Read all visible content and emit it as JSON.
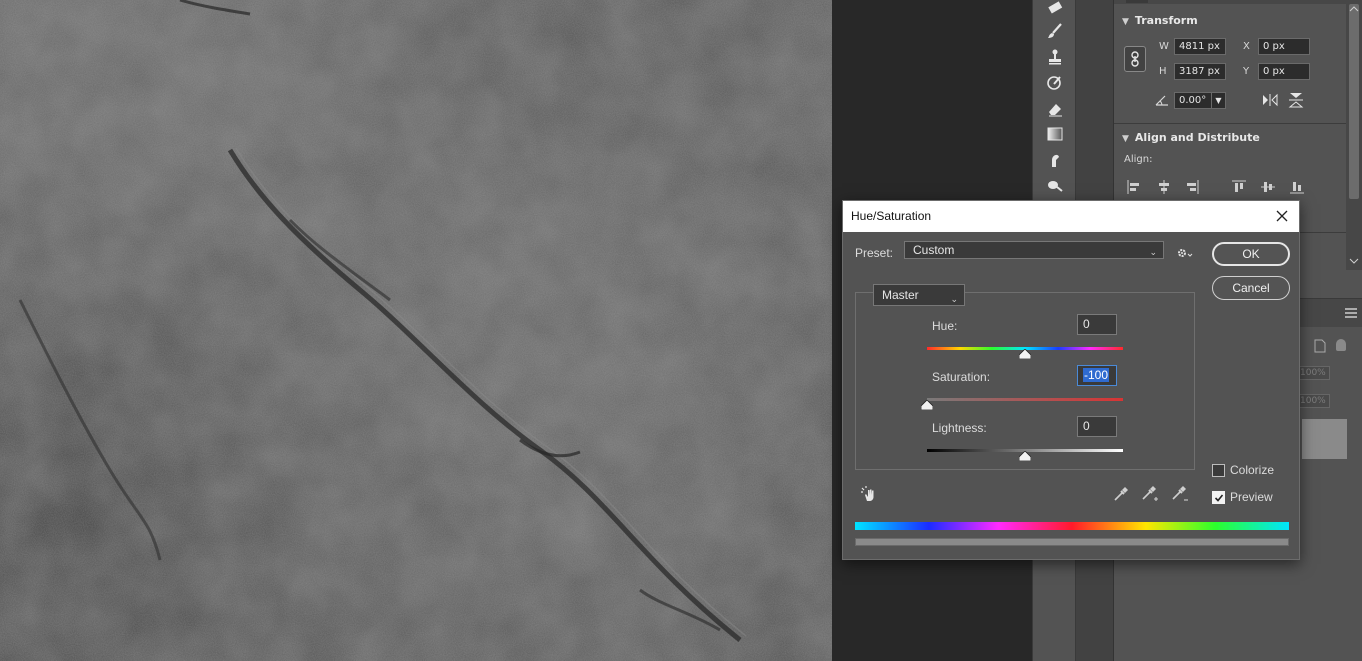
{
  "properties": {
    "transform_title": "Transform",
    "w_label": "W",
    "w_value": "4811 px",
    "h_label": "H",
    "h_value": "3187 px",
    "x_label": "X",
    "x_value": "0 px",
    "y_label": "Y",
    "y_value": "0 px",
    "angle_value": "0.00°",
    "align_title": "Align and Distribute",
    "align_label": "Align:"
  },
  "layers": {
    "opacity_1": "100%",
    "opacity_2": "100%"
  },
  "dialog": {
    "title": "Hue/Saturation",
    "preset_label": "Preset:",
    "preset_value": "Custom",
    "ok_label": "OK",
    "cancel_label": "Cancel",
    "channel_value": "Master",
    "hue_label": "Hue:",
    "hue_value": "0",
    "saturation_label": "Saturation:",
    "saturation_value": "-100",
    "lightness_label": "Lightness:",
    "lightness_value": "0",
    "colorize_label": "Colorize",
    "colorize_checked": false,
    "preview_label": "Preview",
    "preview_checked": true,
    "hue_slider_fraction": 0.5,
    "saturation_slider_fraction": 0.0,
    "lightness_slider_fraction": 0.5
  },
  "icons": [
    "brush-icon",
    "stamp-icon",
    "history-brush-icon",
    "eraser-icon",
    "gradient-icon",
    "smudge-icon",
    "dodge-icon",
    "link-icon",
    "flip-horizontal-icon",
    "flip-vertical-icon",
    "gear-icon",
    "hand-target-icon",
    "eyedropper-icon",
    "eyedropper-plus-icon",
    "eyedropper-minus-icon",
    "close-icon"
  ]
}
